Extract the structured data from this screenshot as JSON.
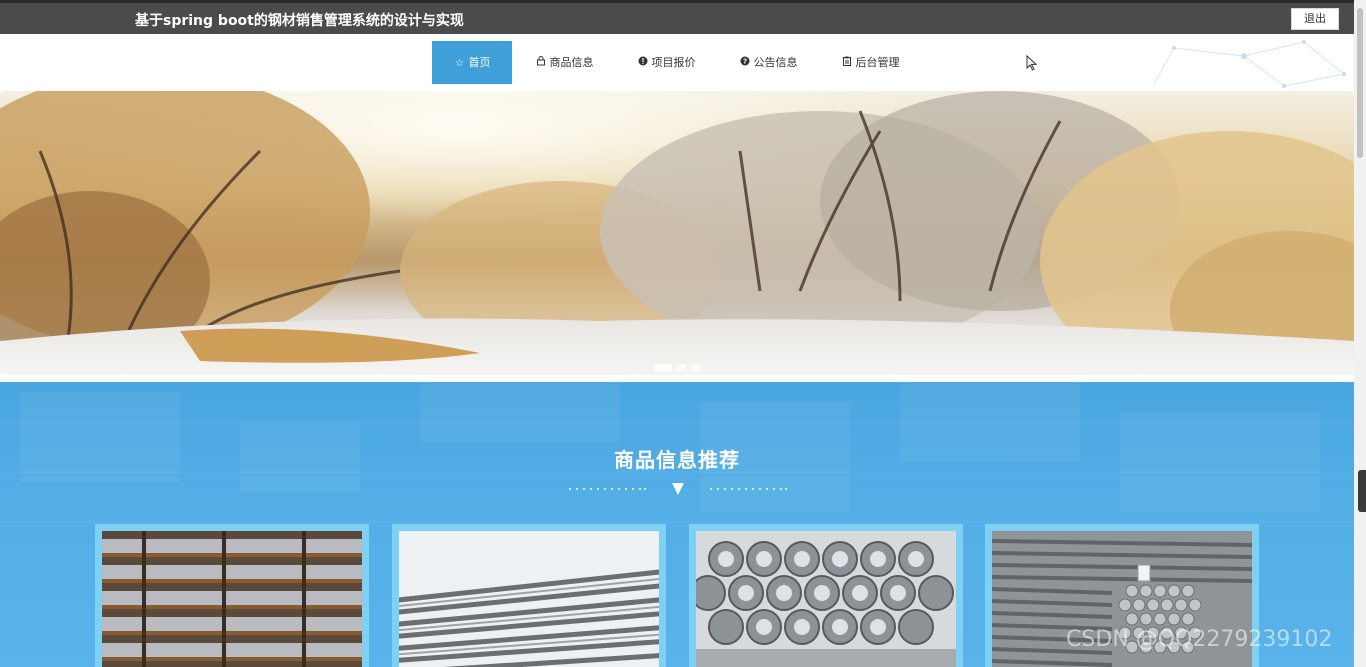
{
  "header": {
    "site_title": "基于spring boot的钢材销售管理系统的设计与实现",
    "logout_label": "退出"
  },
  "nav": {
    "items": [
      {
        "label": "首页",
        "icon": "star-icon",
        "active": true
      },
      {
        "label": "商品信息",
        "icon": "bag-icon",
        "active": false
      },
      {
        "label": "项目报价",
        "icon": "info-circle-icon",
        "active": false
      },
      {
        "label": "公告信息",
        "icon": "question-circle-icon",
        "active": false
      },
      {
        "label": "后台管理",
        "icon": "clipboard-icon",
        "active": false
      }
    ]
  },
  "banner": {
    "slide_count": 3,
    "active_slide": 1
  },
  "products": {
    "section_title": "商品信息推荐",
    "items": [
      {
        "image": "steel-tube-rack-photo"
      },
      {
        "image": "rebar-bundle-photo"
      },
      {
        "image": "wire-coil-photo"
      },
      {
        "image": "rebar-stack-photo"
      }
    ]
  },
  "watermark": "CSDN @QQ2279239102",
  "colors": {
    "topbar": "#4b4b4b",
    "nav_active": "#3f9fd8",
    "section_blue": "#4aa6e0",
    "card_border": "#7fd0f5"
  }
}
